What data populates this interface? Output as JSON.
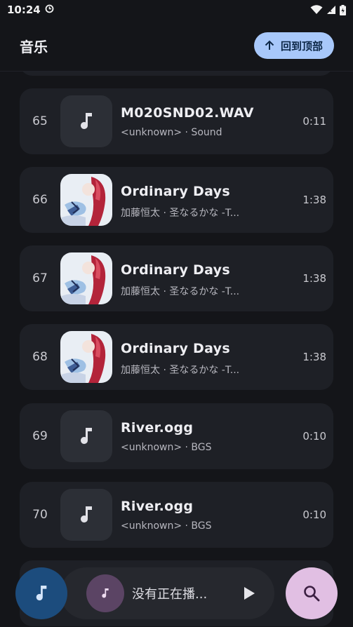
{
  "status_bar": {
    "time": "10:24"
  },
  "app_bar": {
    "title": "音乐",
    "back_to_top_label": "回到顶部"
  },
  "tracks": [
    {
      "number": "65",
      "title": "M020SND02.WAV",
      "subtitle": "<unknown> · Sound",
      "duration": "0:11",
      "has_cover": false
    },
    {
      "number": "66",
      "title": "Ordinary Days",
      "subtitle": "加藤恒太 · 圣なるかな -T...",
      "duration": "1:38",
      "has_cover": true
    },
    {
      "number": "67",
      "title": "Ordinary Days",
      "subtitle": "加藤恒太 · 圣なるかな -T...",
      "duration": "1:38",
      "has_cover": true
    },
    {
      "number": "68",
      "title": "Ordinary Days",
      "subtitle": "加藤恒太 · 圣なるかな -T...",
      "duration": "1:38",
      "has_cover": true
    },
    {
      "number": "69",
      "title": "River.ogg",
      "subtitle": "<unknown> · BGS",
      "duration": "0:10",
      "has_cover": false
    },
    {
      "number": "70",
      "title": "River.ogg",
      "subtitle": "<unknown> · BGS",
      "duration": "0:10",
      "has_cover": false
    }
  ],
  "player": {
    "now_playing": "没有正在播..."
  },
  "icons": {
    "music_note": "music-note-icon",
    "arrow_up": "arrow-up-icon",
    "play": "play-icon",
    "search": "search-icon"
  },
  "colors": {
    "background": "#141519",
    "card": "#1e2026",
    "accent_blue": "#a8c8fa",
    "fab_music": "#1c4c7d",
    "fab_search": "#e1bfe3"
  }
}
